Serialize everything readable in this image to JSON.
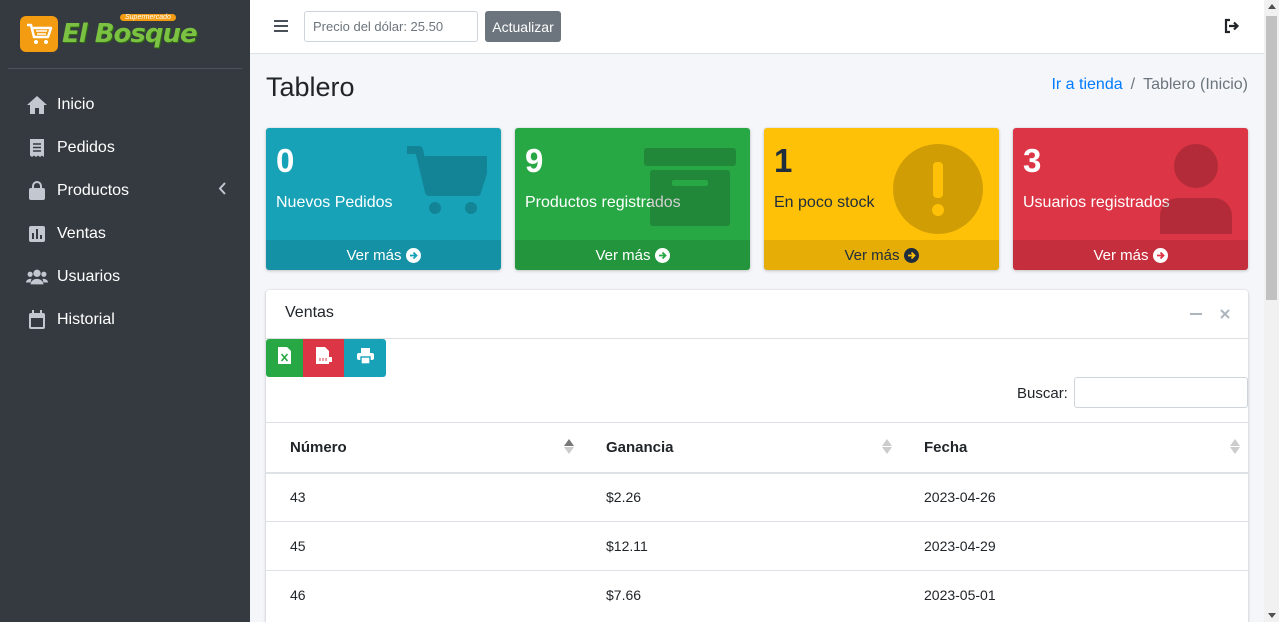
{
  "brand": {
    "name": "El Bosque",
    "tagline": "Supermercado"
  },
  "sidebar": {
    "items": [
      {
        "label": "Inicio",
        "icon": "home-icon"
      },
      {
        "label": "Pedidos",
        "icon": "receipt-icon"
      },
      {
        "label": "Productos",
        "icon": "shopping-bag-icon",
        "has_submenu": true
      },
      {
        "label": "Ventas",
        "icon": "chart-bar-icon"
      },
      {
        "label": "Usuarios",
        "icon": "users-icon"
      },
      {
        "label": "Historial",
        "icon": "calendar-icon"
      }
    ]
  },
  "topbar": {
    "dollar_placeholder": "Precio del dólar: 25.50",
    "update_label": "Actualizar"
  },
  "header": {
    "title": "Tablero",
    "breadcrumb": {
      "link": "Ir a tienda",
      "current": "Tablero (Inicio)"
    }
  },
  "boxes": [
    {
      "value": "0",
      "label": "Nuevos Pedidos",
      "more": "Ver más",
      "color": "#17a2b8",
      "icon": "shopping-cart-icon"
    },
    {
      "value": "9",
      "label": "Productos registrados",
      "more": "Ver más",
      "color": "#28a745",
      "icon": "archive-box-icon"
    },
    {
      "value": "1",
      "label": "En poco stock",
      "more": "Ver más",
      "color": "#ffc107",
      "icon": "exclamation-circle-icon"
    },
    {
      "value": "3",
      "label": "Usuarios registrados",
      "more": "Ver más",
      "color": "#dc3545",
      "icon": "user-icon"
    }
  ],
  "sales": {
    "title": "Ventas",
    "search_label": "Buscar:",
    "columns": [
      "Número",
      "Ganancia",
      "Fecha"
    ],
    "rows": [
      [
        "43",
        "$2.26",
        "2023-04-26"
      ],
      [
        "45",
        "$12.11",
        "2023-04-29"
      ],
      [
        "46",
        "$7.66",
        "2023-05-01"
      ]
    ]
  }
}
